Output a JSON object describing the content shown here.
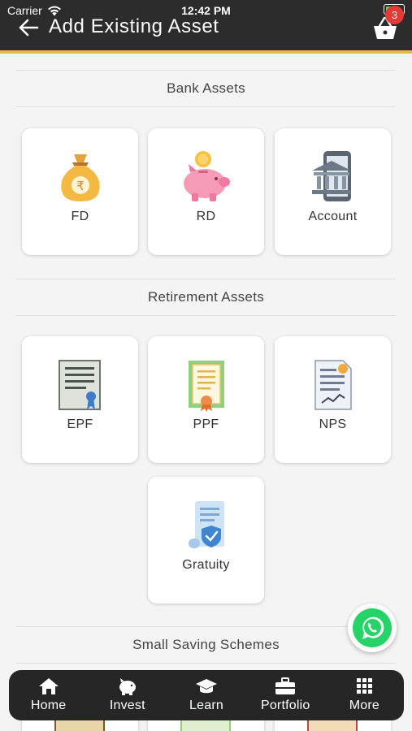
{
  "status_bar": {
    "carrier": "Carrier",
    "time": "12:42 PM"
  },
  "header": {
    "title": "Add Existing Asset",
    "cart_count": "3"
  },
  "sections": [
    {
      "title": "Bank Assets",
      "items": [
        {
          "label": "FD",
          "icon": "money-bag-icon"
        },
        {
          "label": "RD",
          "icon": "piggy-bank-icon"
        },
        {
          "label": "Account",
          "icon": "bank-phone-icon"
        }
      ]
    },
    {
      "title": "Retirement Assets",
      "items": [
        {
          "label": "EPF",
          "icon": "certificate-icon"
        },
        {
          "label": "PPF",
          "icon": "green-certificate-icon"
        },
        {
          "label": "NPS",
          "icon": "document-chart-icon"
        },
        {
          "label": "Gratuity",
          "icon": "scroll-shield-icon"
        }
      ]
    },
    {
      "title": "Small Saving Schemes"
    }
  ],
  "bottom_nav": [
    {
      "label": "Home",
      "icon": "home-icon"
    },
    {
      "label": "Invest",
      "icon": "piggy-bank-icon"
    },
    {
      "label": "Learn",
      "icon": "graduation-cap-icon"
    },
    {
      "label": "Portfolio",
      "icon": "briefcase-icon"
    },
    {
      "label": "More",
      "icon": "grid-icon"
    }
  ],
  "colors": {
    "header_bg": "#2c2c2c",
    "accent": "#e6b94a",
    "badge": "#e53935",
    "whatsapp": "#25d366"
  }
}
